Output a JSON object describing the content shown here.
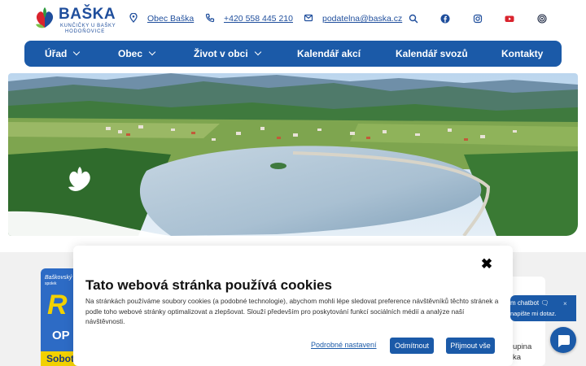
{
  "logo": {
    "title": "BAŠKA",
    "subtitle1": "KUNČIČKY U BAŠKY",
    "subtitle2": "HODOŇOVICE"
  },
  "contacts": [
    {
      "icon": "location-pin-icon",
      "text": "Obec Baška"
    },
    {
      "icon": "phone-icon",
      "text": "+420 558 445 210"
    },
    {
      "icon": "mail-icon",
      "text": "podatelna@baska.cz"
    }
  ],
  "social": [
    "search-icon",
    "facebook-icon",
    "instagram-icon",
    "youtube-icon",
    "podcast-icon"
  ],
  "nav": {
    "items": [
      {
        "label": "Úřad",
        "dropdown": true
      },
      {
        "label": "Obec",
        "dropdown": true
      },
      {
        "label": "Život v obci",
        "dropdown": true
      },
      {
        "label": "Kalendář akcí",
        "dropdown": false
      },
      {
        "label": "Kalendář svozů",
        "dropdown": false
      },
      {
        "label": "Kontakty",
        "dropdown": false
      }
    ]
  },
  "poster": {
    "line1": "Baškovský",
    "line2": "spolek",
    "big_letter": "R",
    "op": "OP",
    "day": "Sobota"
  },
  "side": {
    "line1": "upina",
    "line2": "ka"
  },
  "cookie": {
    "title": "Tato webová stránka používá cookies",
    "text": "Na stránkách používáme soubory cookies (a podobné technologie), abychom mohli lépe sledovat preference návštěvníků těchto stránek a podle toho webové stránky optimalizovat a zlepšovat. Slouží především pro poskytování funkcí sociálních médií a analýze naší návštěvnosti.",
    "settings_label": "Podrobné nastavení",
    "reject_label": "Odmítnout",
    "accept_label": "Přijmout vše",
    "close_symbol": "✖"
  },
  "chat": {
    "line1": "m chatbot 🗨",
    "line2": "napište mi dotaz.",
    "close_symbol": "×"
  },
  "colors": {
    "brand_blue": "#1b5aa8",
    "logo_red": "#d9232d",
    "logo_green": "#2e9a3e"
  }
}
